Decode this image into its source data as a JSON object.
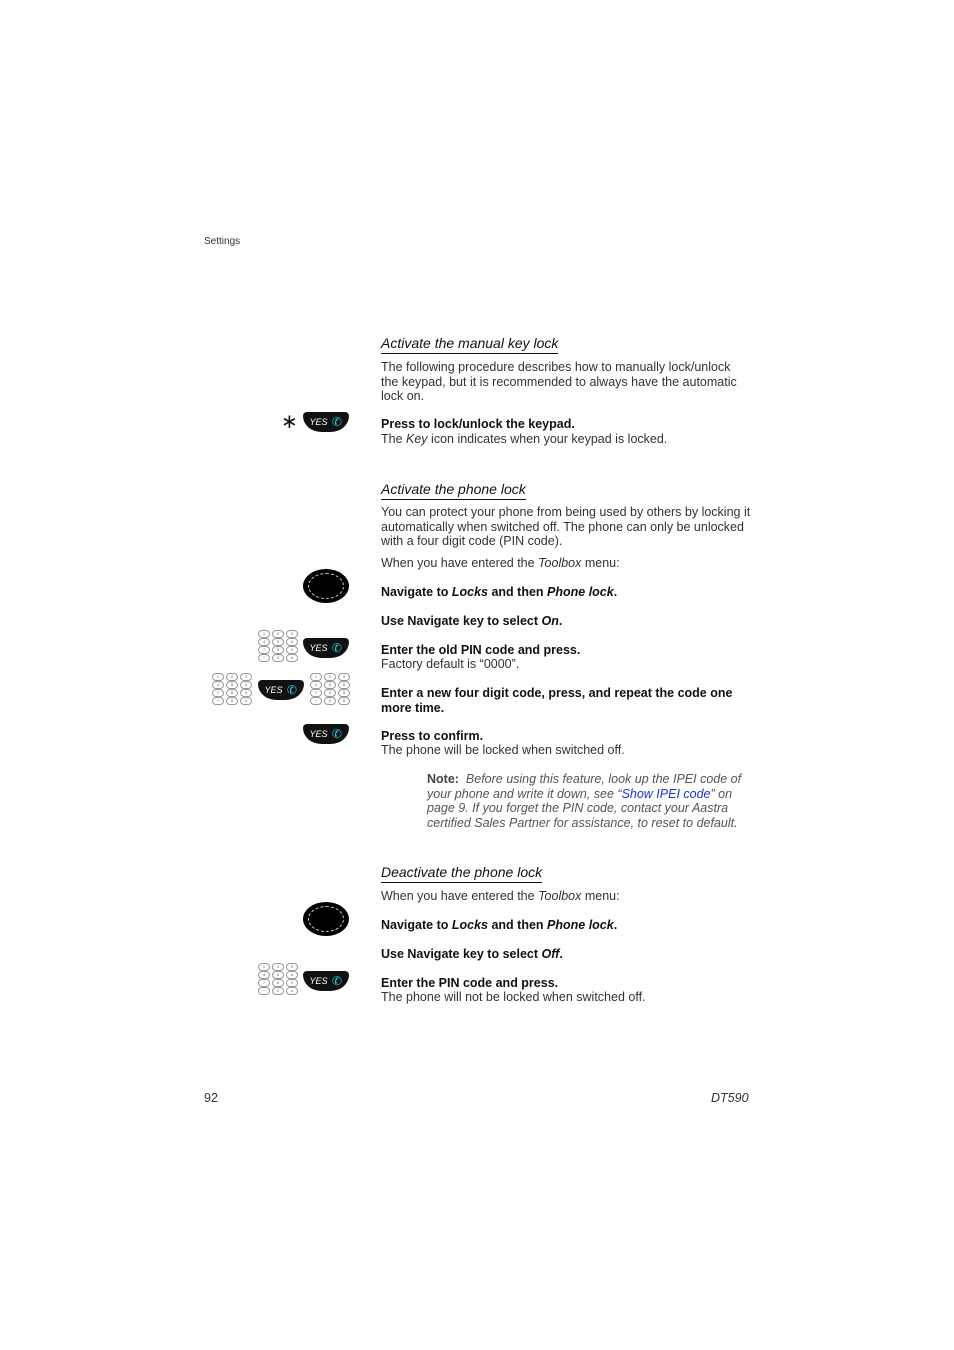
{
  "header": {
    "section": "Settings"
  },
  "sections": [
    {
      "title": "Activate the manual key lock",
      "intro": "The following procedure describes how to manually lock/unlock the keypad, but it is recommended to always have the automatic lock on.",
      "steps": [
        {
          "icons": [
            "star-key",
            "yes-key"
          ],
          "instruction": "Press to lock/unlock the keypad.",
          "detail_pre": "The ",
          "detail_em": "Key",
          "detail_post": " icon indicates when your keypad is locked."
        }
      ]
    },
    {
      "title": "Activate the phone lock",
      "intro": "You can protect your phone from being used by others by locking it automatically when switched off. The phone can only be unlocked with a four digit code (PIN code).",
      "context_pre": "When you have entered the ",
      "context_em": "Toolbox",
      "context_post": " menu:",
      "steps": [
        {
          "icons": [
            "navigation-key"
          ],
          "b1": "Navigate to ",
          "e1": "Locks",
          "b2": " and then ",
          "e2": "Phone lock",
          "b3": "."
        },
        {
          "icons": [],
          "b1": "Use Navigate key to select ",
          "e1": "On",
          "b2": "."
        },
        {
          "icons": [
            "keypad",
            "yes-key"
          ],
          "instruction": "Enter the old PIN code and press.",
          "detail": "Factory default is “0000”."
        },
        {
          "icons": [
            "keypad",
            "yes-key",
            "keypad"
          ],
          "instruction": "Enter a new four digit code, press, and repeat the code one more time."
        },
        {
          "icons": [
            "yes-key"
          ],
          "instruction": "Press to confirm.",
          "detail": "The phone will be locked when switched off."
        }
      ],
      "note": {
        "label": "Note:",
        "text1": "Before using this feature, look up the IPEI code of your phone and write it down, see “",
        "link": "Show IPEI code",
        "text2": "” on page 9",
        "text3": ". If you forget the PIN code, contact your Aastra certified Sales Partner for assistance, to reset to default."
      }
    },
    {
      "title": "Deactivate the phone lock",
      "context_pre": "When you have entered the ",
      "context_em": "Toolbox",
      "context_post": " menu:",
      "steps": [
        {
          "icons": [
            "navigation-key"
          ],
          "b1": "Navigate to ",
          "e1": "Locks",
          "b2": " and then ",
          "e2": "Phone lock",
          "b3": "."
        },
        {
          "icons": [],
          "b1": "Use Navigate key to select ",
          "e1": "Off",
          "b2": "."
        },
        {
          "icons": [
            "keypad",
            "yes-key"
          ],
          "instruction": "Enter the PIN code and press.",
          "detail": "The phone will not be locked when switched off."
        }
      ]
    }
  ],
  "icons": {
    "yes_label": "YES",
    "star": "∗",
    "phone": "✆",
    "keys": [
      "1",
      "2",
      "3",
      "4",
      "5",
      "6",
      "7",
      "8",
      "9",
      "*",
      "0",
      "#"
    ]
  },
  "footer": {
    "page_number": "92",
    "model": "DT590"
  }
}
